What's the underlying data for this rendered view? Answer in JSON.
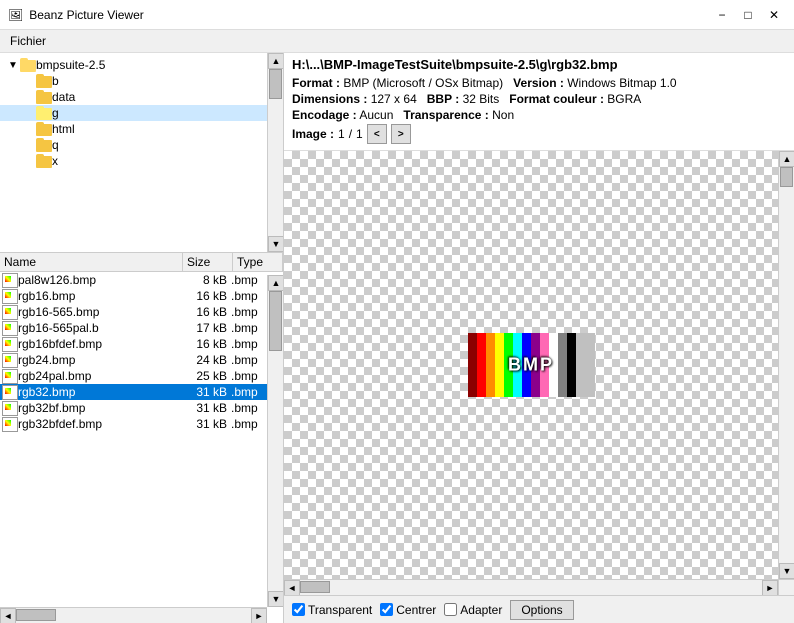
{
  "window": {
    "title": "Beanz Picture Viewer",
    "icon": "🖼"
  },
  "titlebar": {
    "minimize": "−",
    "maximize": "□",
    "close": "✕"
  },
  "menubar": {
    "items": [
      {
        "label": "Fichier",
        "id": "fichier"
      }
    ]
  },
  "left": {
    "tree": {
      "items": [
        {
          "id": "bmpsuite",
          "label": "bmpsuite-2.5",
          "level": 0,
          "expanded": true,
          "selected": false
        },
        {
          "id": "b",
          "label": "b",
          "level": 1,
          "expanded": false,
          "selected": false
        },
        {
          "id": "data",
          "label": "data",
          "level": 1,
          "expanded": false,
          "selected": false
        },
        {
          "id": "g",
          "label": "g",
          "level": 1,
          "expanded": false,
          "selected": true
        },
        {
          "id": "html",
          "label": "html",
          "level": 1,
          "expanded": false,
          "selected": false
        },
        {
          "id": "q",
          "label": "q",
          "level": 1,
          "expanded": false,
          "selected": false
        },
        {
          "id": "x",
          "label": "x",
          "level": 1,
          "expanded": false,
          "selected": false
        }
      ]
    },
    "fileList": {
      "columns": [
        {
          "id": "name",
          "label": "Name"
        },
        {
          "id": "size",
          "label": "Size"
        },
        {
          "id": "type",
          "label": "Type"
        }
      ],
      "files": [
        {
          "name": "pal8w126.bmp",
          "size": "8 kB",
          "type": ".bmp",
          "selected": false
        },
        {
          "name": "rgb16.bmp",
          "size": "16 kB",
          "type": ".bmp",
          "selected": false
        },
        {
          "name": "rgb16-565.bmp",
          "size": "16 kB",
          "type": ".bmp",
          "selected": false
        },
        {
          "name": "rgb16-565pal.b",
          "size": "17 kB",
          "type": ".bmp",
          "selected": false
        },
        {
          "name": "rgb16bfdef.bmp",
          "size": "16 kB",
          "type": ".bmp",
          "selected": false
        },
        {
          "name": "rgb24.bmp",
          "size": "24 kB",
          "type": ".bmp",
          "selected": false
        },
        {
          "name": "rgb24pal.bmp",
          "size": "25 kB",
          "type": ".bmp",
          "selected": false
        },
        {
          "name": "rgb32.bmp",
          "size": "31 kB",
          "type": ".bmp",
          "selected": true
        },
        {
          "name": "rgb32bf.bmp",
          "size": "31 kB",
          "type": ".bmp",
          "selected": false
        },
        {
          "name": "rgb32bfdef.bmp",
          "size": "31 kB",
          "type": ".bmp",
          "selected": false
        }
      ]
    }
  },
  "right": {
    "path": "H:\\...\\BMP-ImageTestSuite\\bmpsuite-2.5\\g\\rgb32.bmp",
    "format_label": "Format :",
    "format_value": "BMP (Microsoft / OSx Bitmap)",
    "version_label": "Version :",
    "version_value": "Windows Bitmap 1.0",
    "dimensions_label": "Dimensions :",
    "dimensions_value": "127 x 64",
    "bbp_label": "BBP :",
    "bbp_value": "32 Bits",
    "format_couleur_label": "Format couleur :",
    "format_couleur_value": "BGRA",
    "encodage_label": "Encodage :",
    "encodage_value": "Aucun",
    "transparence_label": "Transparence :",
    "transparence_value": "Non",
    "image_label": "Image :",
    "image_current": "1",
    "image_separator": "/",
    "image_total": "1",
    "nav_prev": "<",
    "nav_next": ">"
  },
  "toolbar": {
    "transparent_label": "Transparent",
    "centrer_label": "Centrer",
    "adapter_label": "Adapter",
    "options_label": "Options",
    "transparent_checked": true,
    "centrer_checked": true,
    "adapter_checked": false
  }
}
